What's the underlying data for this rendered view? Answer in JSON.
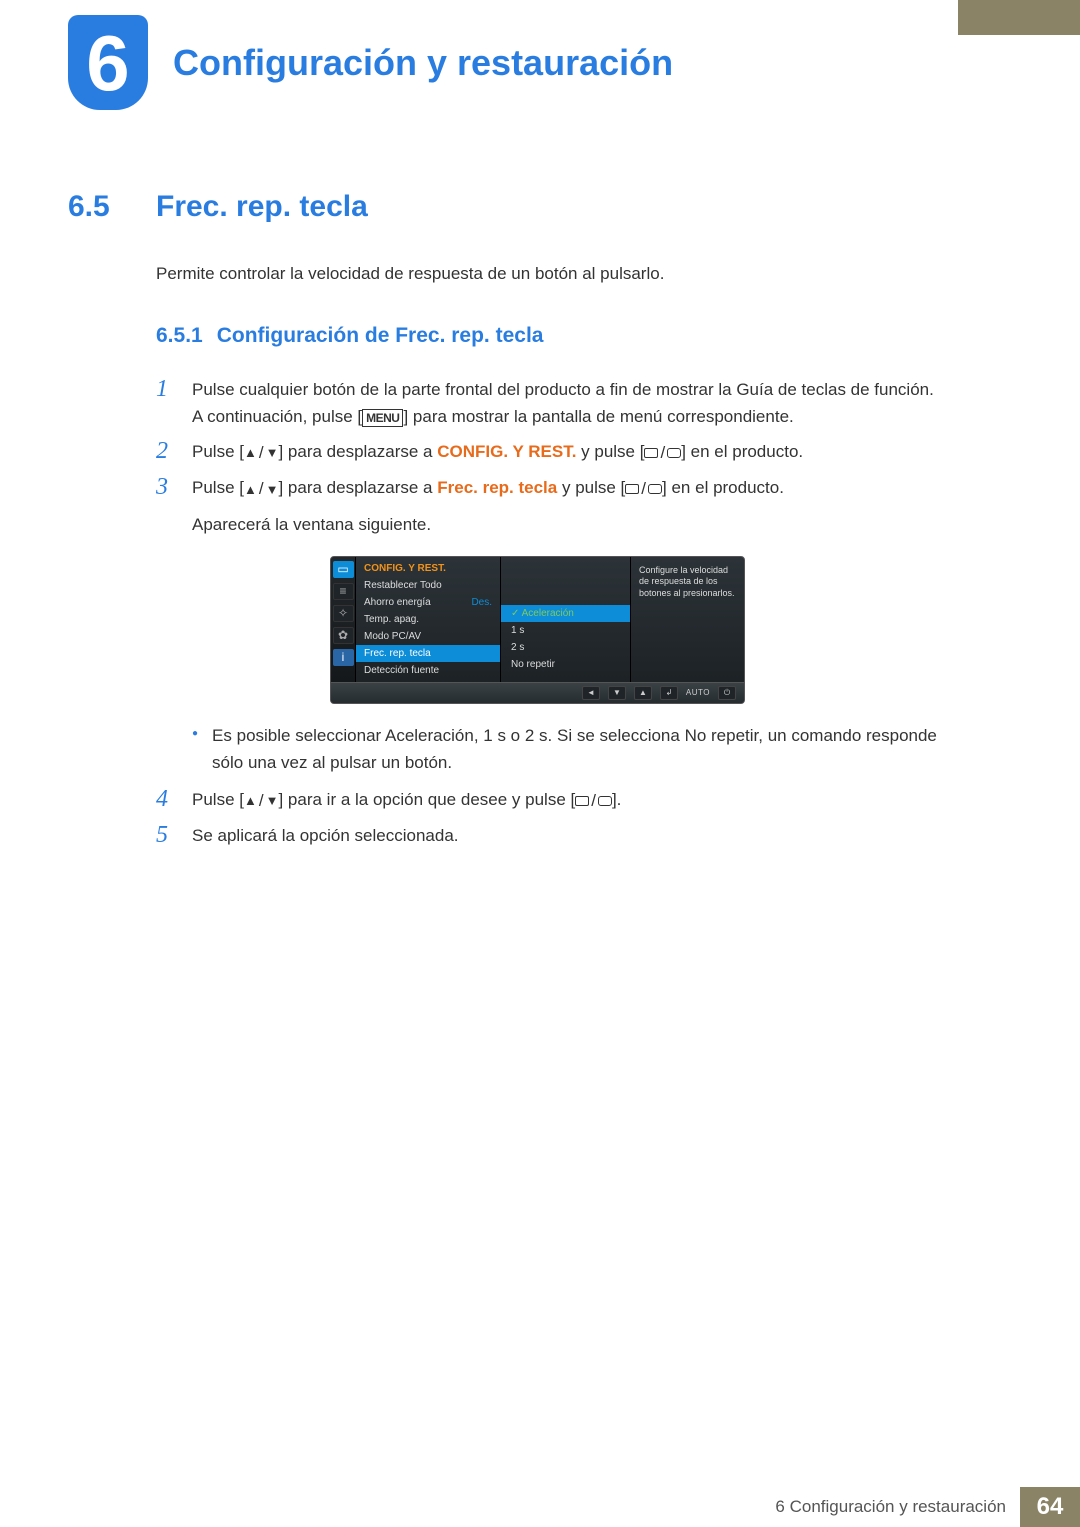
{
  "chapter": {
    "number": "6",
    "title": "Configuración y restauración"
  },
  "section": {
    "number": "6.5",
    "title": "Frec. rep. tecla"
  },
  "intro": "Permite controlar la velocidad de respuesta de un botón al pulsarlo.",
  "subsection": {
    "number": "6.5.1",
    "title": "Configuración de Frec. rep. tecla"
  },
  "steps": {
    "s1_a": "Pulse cualquier botón de la parte frontal del producto a fin de mostrar la Guía de teclas de función.",
    "s1_b_pre": "A continuación, pulse [",
    "s1_menu": "MENU",
    "s1_b_post": "] para mostrar la pantalla de menú correspondiente.",
    "s2_pre": "Pulse [",
    "s2_mid": "] para desplazarse a ",
    "s2_tgt": "CONFIG. Y REST.",
    "s2_post": " y pulse [",
    "s2_end": "] en el producto.",
    "s3_pre": "Pulse [",
    "s3_mid": "] para desplazarse a ",
    "s3_tgt": "Frec. rep. tecla",
    "s3_post": " y pulse [",
    "s3_end": "] en el producto.",
    "s3_after": "Aparecerá la ventana siguiente.",
    "bullet_pre": "Es posible seleccionar ",
    "bullet_op1": "Aceleración",
    "bullet_op2": "1 s",
    "bullet_o": " o ",
    "bullet_op3": "2 s",
    "bullet_mid": ". Si se selecciona ",
    "bullet_op4": "No repetir",
    "bullet_post": ", un comando responde sólo una vez al pulsar un botón.",
    "s4_pre": "Pulse [",
    "s4_mid": "] para ir a la opción que desee y pulse [",
    "s4_end": "].",
    "s5": "Se aplicará la opción seleccionada."
  },
  "step_numbers": {
    "n1": "1",
    "n2": "2",
    "n3": "3",
    "n4": "4",
    "n5": "5"
  },
  "osd": {
    "header": "CONFIG. Y REST.",
    "items": [
      {
        "label": "Restablecer Todo",
        "value": ""
      },
      {
        "label": "Ahorro energía",
        "value": "Des."
      },
      {
        "label": "Temp. apag.",
        "value": ""
      },
      {
        "label": "Modo PC/AV",
        "value": ""
      },
      {
        "label": "Frec. rep. tecla",
        "value": ""
      },
      {
        "label": "Detección fuente",
        "value": ""
      }
    ],
    "options": [
      "Aceleración",
      "1 s",
      "2 s",
      "No repetir"
    ],
    "info": "Configure la velocidad de respuesta de los botones al presionarlos.",
    "footer_auto": "AUTO"
  },
  "footer": {
    "label": "6 Configuración y restauración",
    "page": "64"
  }
}
